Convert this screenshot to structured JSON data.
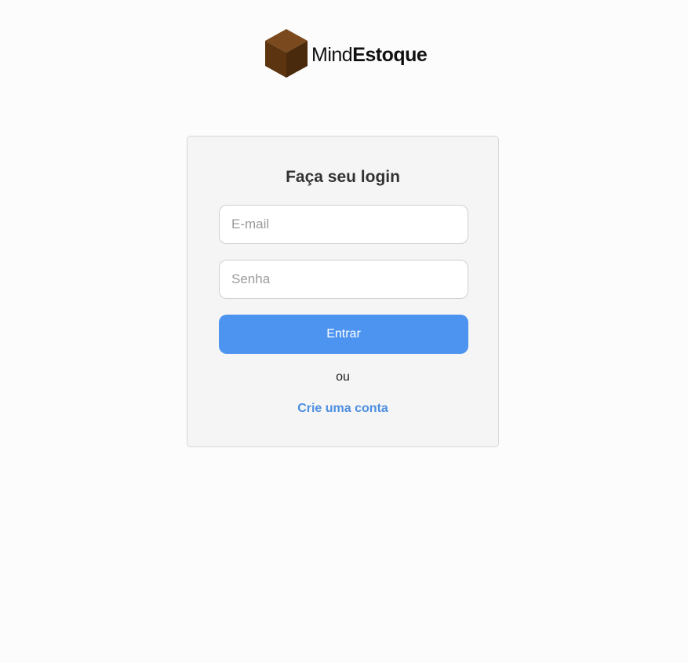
{
  "brand": {
    "name_light": "Mind",
    "name_bold": "Estoque",
    "icon": "cube-icon",
    "icon_colors": [
      "#7a4a1e",
      "#5c3510",
      "#4a2a0c"
    ]
  },
  "login": {
    "title": "Faça seu login",
    "email_placeholder": "E-mail",
    "email_value": "",
    "password_placeholder": "Senha",
    "password_value": "",
    "submit_label": "Entrar",
    "or_label": "ou",
    "signup_label": "Crie uma conta"
  },
  "colors": {
    "accent": "#4d94f0",
    "link": "#4d8fe0",
    "card_bg": "#f5f5f5",
    "page_bg": "#fcfcfc"
  }
}
